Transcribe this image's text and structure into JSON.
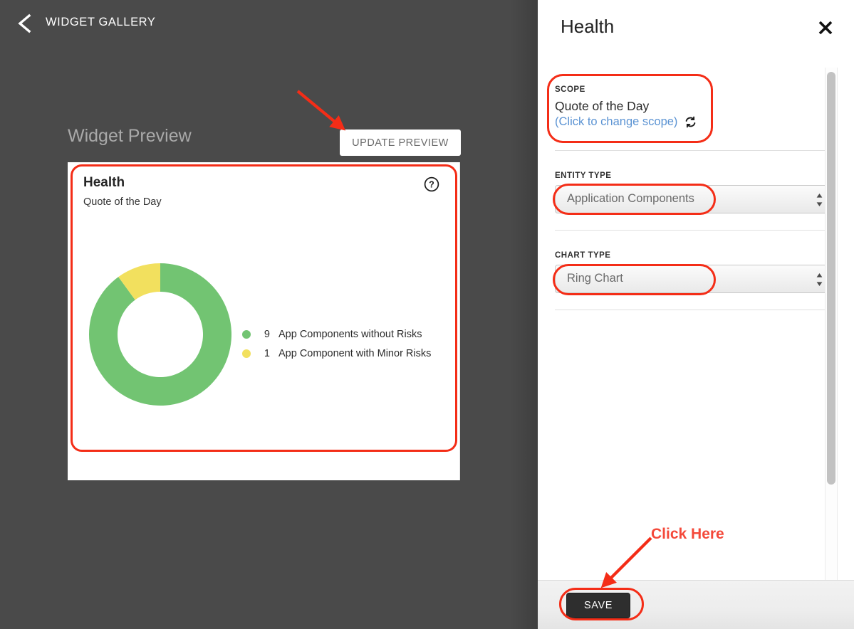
{
  "app": {
    "background_color": "#4a4a4a",
    "accent_annotation_color": "#f42d17"
  },
  "topbar": {
    "back_icon": "chevron-left-icon",
    "title": "WIDGET GALLERY"
  },
  "preview": {
    "label": "Widget Preview",
    "update_button": "UPDATE PREVIEW"
  },
  "widget_card": {
    "title": "Health",
    "subtitle": "Quote of the Day",
    "help_icon": "question-circle-icon"
  },
  "chart_data": {
    "type": "pie",
    "variant": "ring",
    "title": "Health",
    "subtitle": "Quote of the Day",
    "total": 10,
    "start_angle_deg": 0,
    "direction": "clockwise",
    "inner_radius_ratio": 0.6,
    "legend_position": "right",
    "categories": [
      "App Components without Risks",
      "App Component with Minor Risks"
    ],
    "values": [
      9,
      1
    ],
    "colors": [
      "#72c472",
      "#f2e05e"
    ],
    "slices": [
      {
        "label": "App Components without Risks",
        "value": 9,
        "color": "#72c472",
        "percent": 90
      },
      {
        "label": "App Component with Minor Risks",
        "value": 1,
        "color": "#f2e05e",
        "percent": 10
      }
    ]
  },
  "panel": {
    "title": "Health",
    "close_icon": "close-icon",
    "scope": {
      "label": "SCOPE",
      "value": "Quote of the Day",
      "change_link": "(Click to change scope)",
      "refresh_icon": "refresh-icon"
    },
    "entity_type": {
      "label": "ENTITY TYPE",
      "value": "Application Components",
      "stepper_icon": "up-down-arrows-icon"
    },
    "chart_type": {
      "label": "CHART TYPE",
      "value": "Ring Chart",
      "stepper_icon": "up-down-arrows-icon"
    },
    "footer": {
      "save_button": "SAVE"
    }
  },
  "annotations": {
    "click_here": "Click Here",
    "arrow_color": "#f42d17"
  }
}
